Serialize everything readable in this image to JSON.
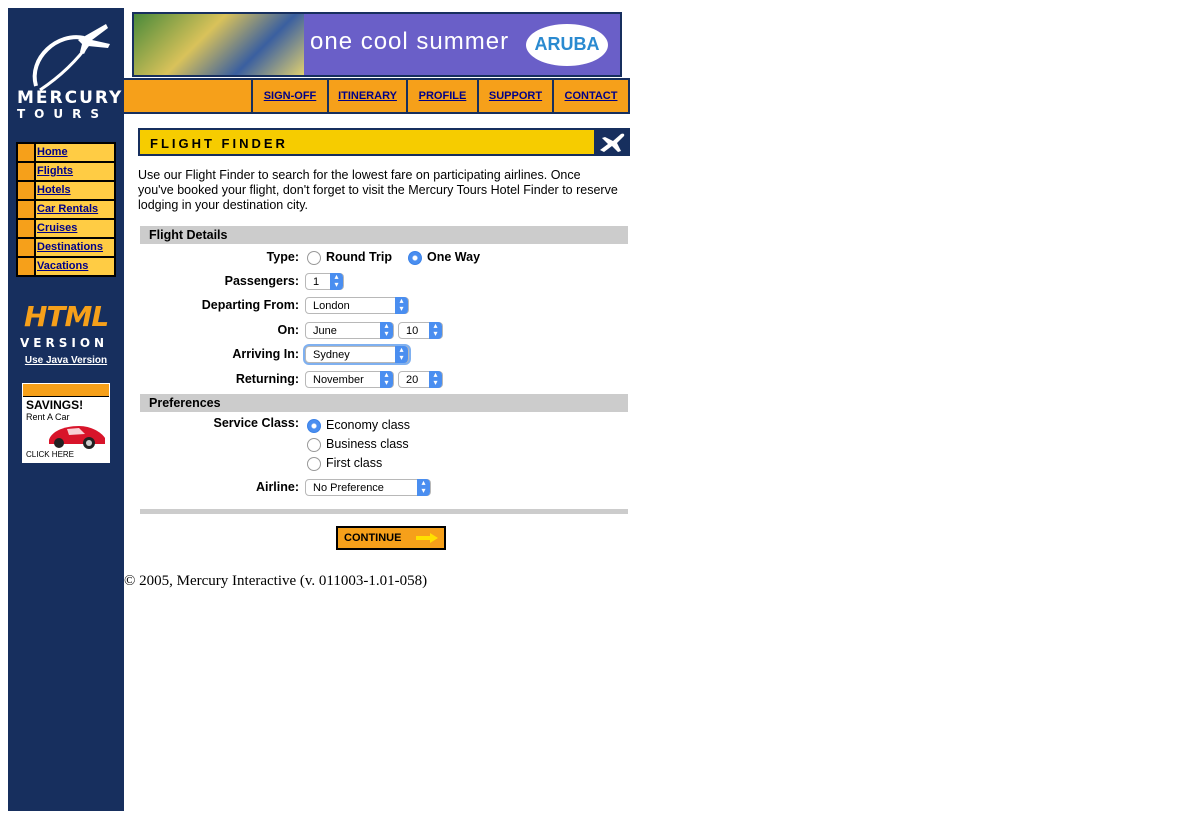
{
  "logo": {
    "line1": "MERCURY",
    "line2": "TOURS"
  },
  "sidebar": {
    "items": [
      {
        "label": "Home"
      },
      {
        "label": "Flights"
      },
      {
        "label": "Hotels"
      },
      {
        "label": "Car Rentals"
      },
      {
        "label": "Cruises"
      },
      {
        "label": "Destinations"
      },
      {
        "label": "Vacations"
      }
    ],
    "html_version_big": "HTML",
    "html_version_small": "VERSION",
    "java_link": "Use Java Version",
    "ad": {
      "title": "SAVINGS!",
      "subtitle": "Rent A Car",
      "click": "CLICK HERE"
    }
  },
  "banner": {
    "text": "one cool summer",
    "logo": "ARUBA"
  },
  "topnav": [
    "SIGN-OFF",
    "ITINERARY",
    "PROFILE",
    "SUPPORT",
    "CONTACT"
  ],
  "page": {
    "title": "FLIGHT FINDER",
    "intro": "Use our Flight Finder to search for the lowest fare on participating airlines. Once you've booked your flight, don't forget to visit the Mercury Tours Hotel Finder to reserve lodging in your destination city."
  },
  "flight_details": {
    "heading": "Flight Details",
    "type_label": "Type:",
    "type_options": [
      "Round Trip",
      "One Way"
    ],
    "type_selected": "One Way",
    "passengers_label": "Passengers:",
    "passengers": "1",
    "departing_label": "Departing From:",
    "departing": "London",
    "on_label": "On:",
    "on_month": "June",
    "on_day": "10",
    "arriving_label": "Arriving In:",
    "arriving": "Sydney",
    "returning_label": "Returning:",
    "returning_month": "November",
    "returning_day": "20"
  },
  "preferences": {
    "heading": "Preferences",
    "class_label": "Service Class:",
    "classes": [
      "Economy class",
      "Business class",
      "First class"
    ],
    "class_selected": "Economy class",
    "airline_label": "Airline:",
    "airline": "No Preference"
  },
  "continue_label": "CONTINUE",
  "footer": "© 2005, Mercury Interactive (v. 011003-1.01-058)",
  "colors": {
    "navy": "#172f5e",
    "orange": "#f6a01a",
    "yellow": "#f6cc00",
    "link": "#000088"
  }
}
